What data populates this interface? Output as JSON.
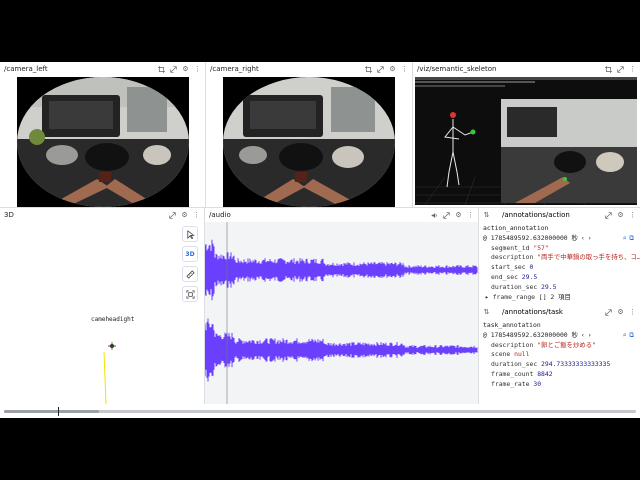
{
  "panels": {
    "camera_left": {
      "title": "/camera_left"
    },
    "camera_right": {
      "title": "/camera_right"
    },
    "viz": {
      "title": "/viz/semantic_skeleton"
    },
    "view3d": {
      "title": "3D",
      "entity_label": "cameheadight",
      "toolbar": {
        "view_label": "3D"
      }
    },
    "audio": {
      "title": "/audio"
    },
    "action": {
      "title": "/annotations/action",
      "heading": "action_annotation",
      "timestamp": "@ 1785489592.632000000 秒",
      "fields": [
        {
          "key": "segment_id",
          "value": "\"57\"",
          "type": "str"
        },
        {
          "key": "description",
          "value": "\"両手で中華鍋の取っ手を持ち、コ…",
          "type": "str"
        },
        {
          "key": "start_sec",
          "value": "0",
          "type": "num"
        },
        {
          "key": "end_sec",
          "value": "29.5",
          "type": "num"
        },
        {
          "key": "duration_sec",
          "value": "29.5",
          "type": "num"
        },
        {
          "key": "frame_range",
          "value": "[] 2 項目",
          "type": "list"
        }
      ]
    },
    "task": {
      "title": "/annotations/task",
      "heading": "task_annotation",
      "timestamp": "@ 1785489592.632000000 秒",
      "fields": [
        {
          "key": "description",
          "value": "\"卵とご飯を炒める\"",
          "type": "str"
        },
        {
          "key": "scene",
          "value": "null",
          "type": "str"
        },
        {
          "key": "duration_sec",
          "value": "294.73333333333335",
          "type": "num"
        },
        {
          "key": "frame_count",
          "value": "8842",
          "type": "num"
        },
        {
          "key": "frame_rate",
          "value": "30",
          "type": "num"
        }
      ]
    }
  },
  "timeline": {
    "position": 0.086
  },
  "colors": {
    "audio_wave": "#5b2cff",
    "accent": "#2b6cd3",
    "skeleton": "#e8e8e8",
    "camera_ray": "#f5e400"
  },
  "icons": [
    "crop-icon",
    "expand-icon",
    "gear-icon",
    "more-icon",
    "volume-icon",
    "chevron-left-icon",
    "chevron-right-icon",
    "search-icon",
    "copy-icon",
    "pointer-icon",
    "ruler-icon",
    "fit-icon",
    "sort-icon"
  ]
}
